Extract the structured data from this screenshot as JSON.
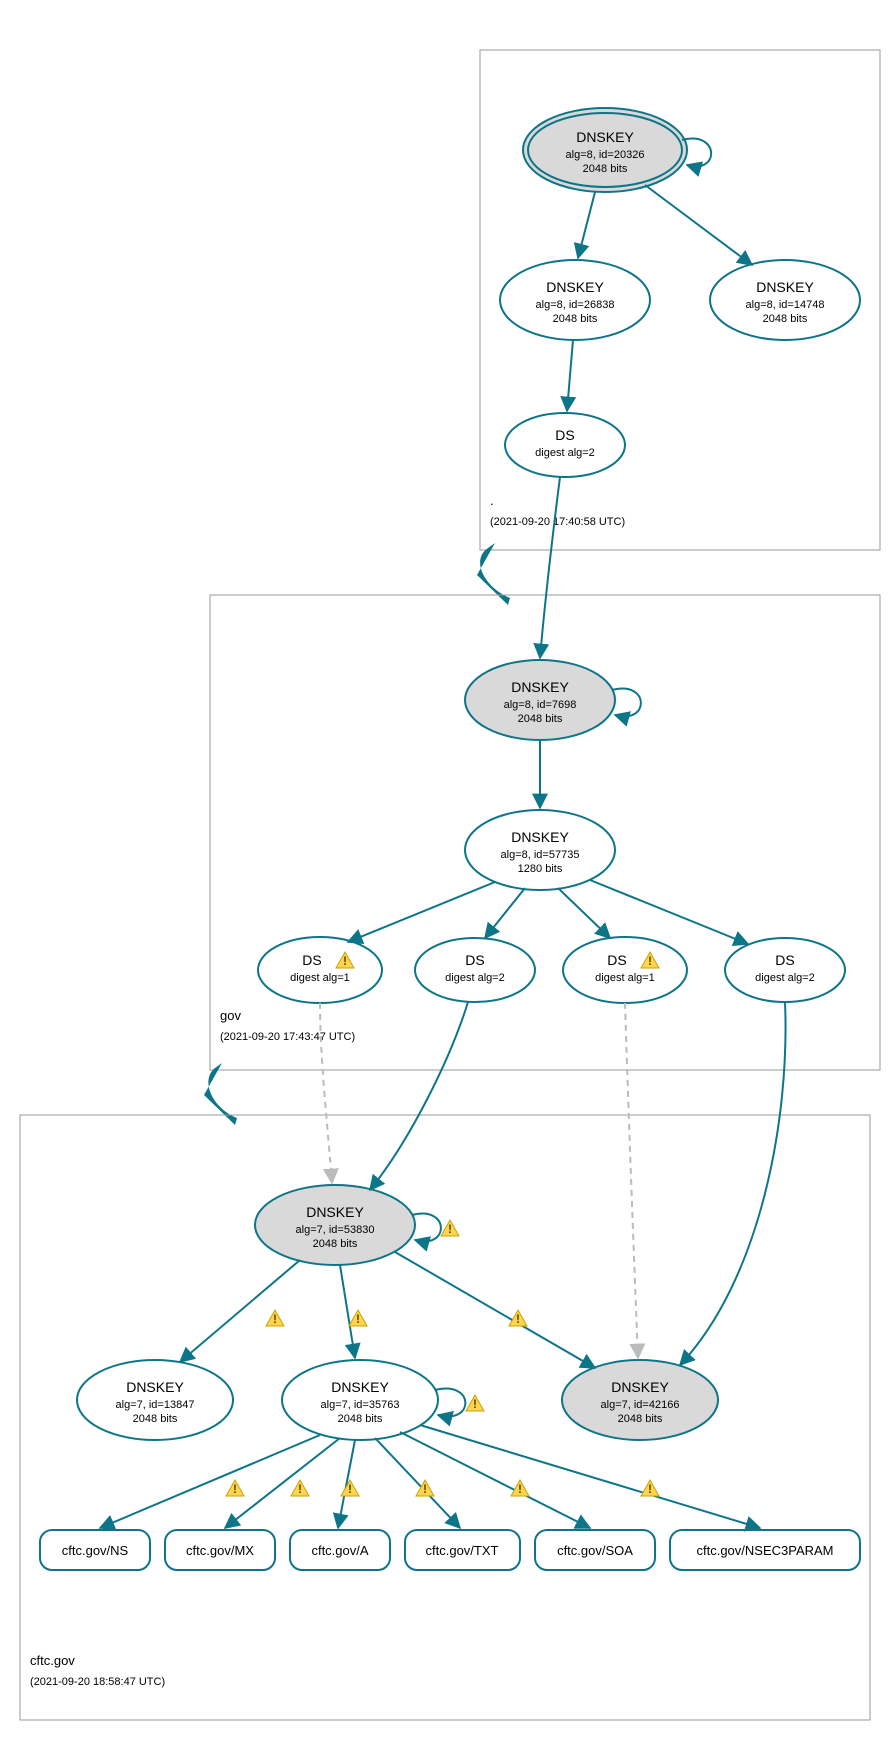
{
  "zones": {
    "root": {
      "label": ".",
      "timestamp": "(2021-09-20 17:40:58 UTC)"
    },
    "gov": {
      "label": "gov",
      "timestamp": "(2021-09-20 17:43:47 UTC)"
    },
    "cftc": {
      "label": "cftc.gov",
      "timestamp": "(2021-09-20 18:58:47 UTC)"
    }
  },
  "nodes": {
    "root_ksk": {
      "title": "DNSKEY",
      "line1": "alg=8, id=20326",
      "line2": "2048 bits"
    },
    "root_zsk1": {
      "title": "DNSKEY",
      "line1": "alg=8, id=26838",
      "line2": "2048 bits"
    },
    "root_zsk2": {
      "title": "DNSKEY",
      "line1": "alg=8, id=14748",
      "line2": "2048 bits"
    },
    "root_ds": {
      "title": "DS",
      "line1": "digest alg=2"
    },
    "gov_ksk": {
      "title": "DNSKEY",
      "line1": "alg=8, id=7698",
      "line2": "2048 bits"
    },
    "gov_zsk": {
      "title": "DNSKEY",
      "line1": "alg=8, id=57735",
      "line2": "1280 bits"
    },
    "gov_ds1": {
      "title": "DS",
      "line1": "digest alg=1"
    },
    "gov_ds2": {
      "title": "DS",
      "line1": "digest alg=2"
    },
    "gov_ds3": {
      "title": "DS",
      "line1": "digest alg=1"
    },
    "gov_ds4": {
      "title": "DS",
      "line1": "digest alg=2"
    },
    "cftc_ksk": {
      "title": "DNSKEY",
      "line1": "alg=7, id=53830",
      "line2": "2048 bits"
    },
    "cftc_k1": {
      "title": "DNSKEY",
      "line1": "alg=7, id=13847",
      "line2": "2048 bits"
    },
    "cftc_k2": {
      "title": "DNSKEY",
      "line1": "alg=7, id=35763",
      "line2": "2048 bits"
    },
    "cftc_k3": {
      "title": "DNSKEY",
      "line1": "alg=7, id=42166",
      "line2": "2048 bits"
    },
    "rr_ns": {
      "label": "cftc.gov/NS"
    },
    "rr_mx": {
      "label": "cftc.gov/MX"
    },
    "rr_a": {
      "label": "cftc.gov/A"
    },
    "rr_txt": {
      "label": "cftc.gov/TXT"
    },
    "rr_soa": {
      "label": "cftc.gov/SOA"
    },
    "rr_n3p": {
      "label": "cftc.gov/NSEC3PARAM"
    }
  }
}
